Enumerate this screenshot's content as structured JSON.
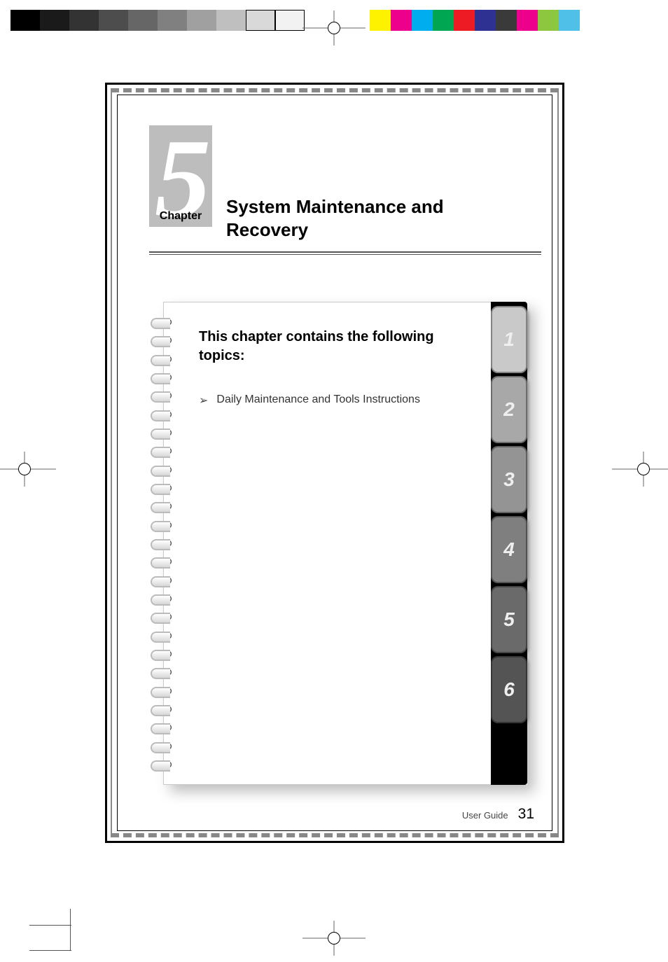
{
  "registration": {
    "grays": [
      "#000000",
      "#1a1a1a",
      "#333333",
      "#4d4d4d",
      "#666666",
      "#808080",
      "#a0a0a0",
      "#bfbfbf",
      "#d9d9d9",
      "#f2f2f2"
    ],
    "colors": [
      "#fff200",
      "#ec008c",
      "#00aeef",
      "#00a651",
      "#ed1c24",
      "#2e3192",
      "#3a3a3a",
      "#ec008c",
      "#8dc63f",
      "#4fc1e9"
    ]
  },
  "chapter": {
    "number": "5",
    "label": "Chapter",
    "title": "System Maintenance and Recovery"
  },
  "notebook": {
    "intro": "This chapter contains the following topics:",
    "topics": [
      "Daily Maintenance and Tools Instructions"
    ],
    "tabs": [
      {
        "n": "1",
        "bg": "#c9c9c9"
      },
      {
        "n": "2",
        "bg": "#a8a8a8"
      },
      {
        "n": "3",
        "bg": "#949494"
      },
      {
        "n": "4",
        "bg": "#7f7f7f"
      },
      {
        "n": "5",
        "bg": "#6a6a6a"
      },
      {
        "n": "6",
        "bg": "#545454"
      }
    ]
  },
  "footer": {
    "label": "User Guide",
    "page": "31"
  }
}
